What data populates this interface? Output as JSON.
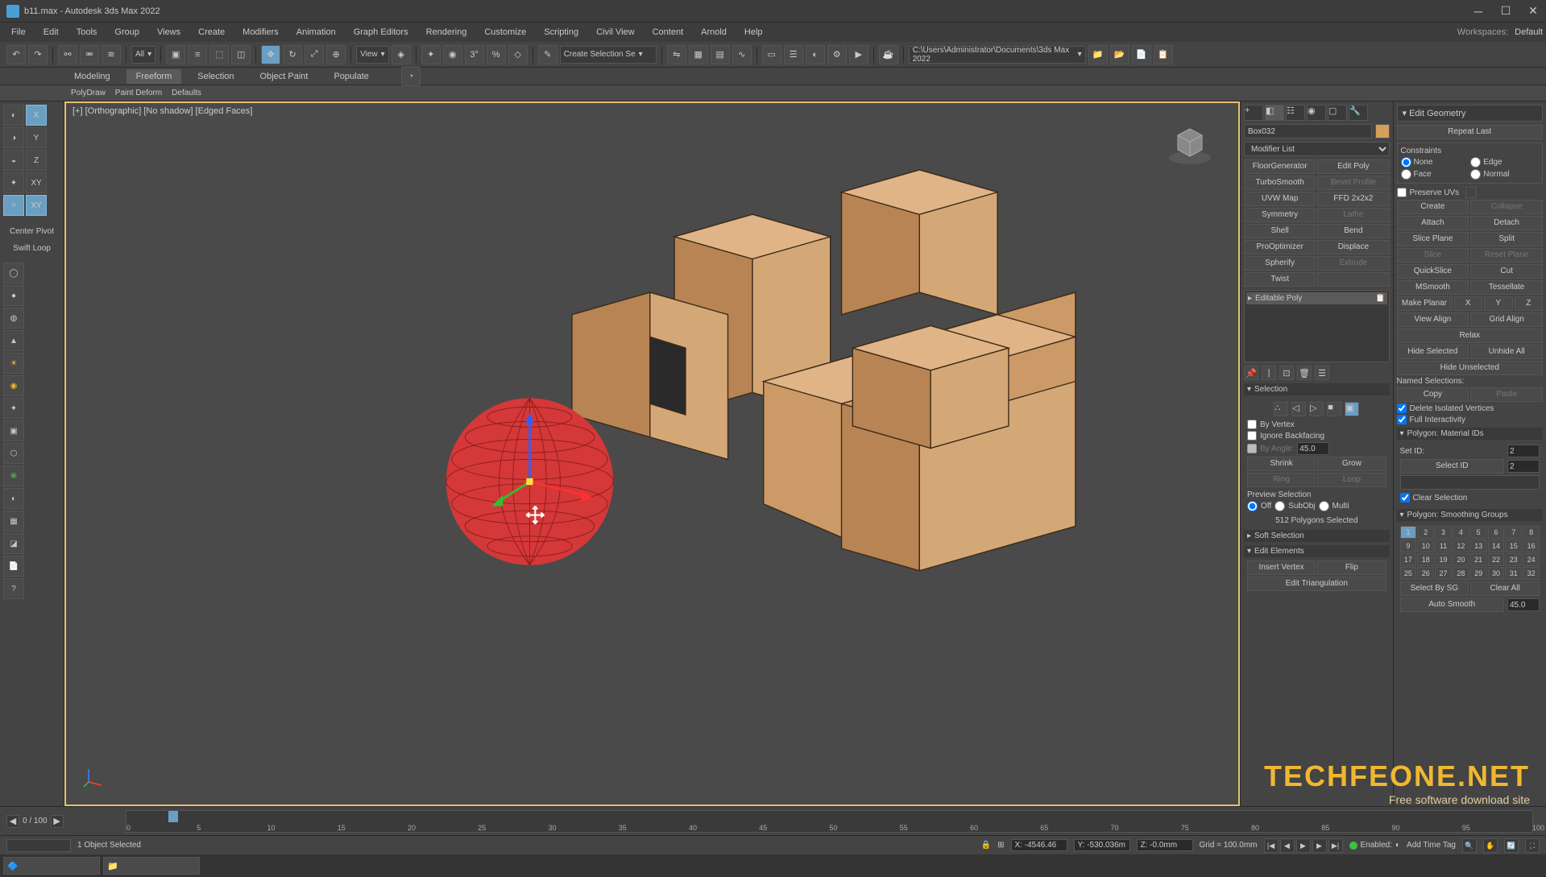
{
  "title": "b11.max - Autodesk 3ds Max 2022",
  "menu": [
    "File",
    "Edit",
    "Tools",
    "Group",
    "Views",
    "Create",
    "Modifiers",
    "Animation",
    "Graph Editors",
    "Rendering",
    "Customize",
    "Scripting",
    "Civil View",
    "Content",
    "Arnold",
    "Help"
  ],
  "workspace_label": "Workspaces:",
  "workspace_value": "Default",
  "toolbar_all": "All",
  "toolbar_view": "View",
  "toolbar_selectionset": "Create Selection Se",
  "toolbar_path": "C:\\Users\\Administrator\\Documents\\3ds Max 2022",
  "ribbon": [
    "Modeling",
    "Freeform",
    "Selection",
    "Object Paint",
    "Populate"
  ],
  "ribbon_active": "Freeform",
  "subribbon": [
    "PolyDraw",
    "Paint Deform",
    "Defaults"
  ],
  "left_axis": [
    "X",
    "Y",
    "Z",
    "XY",
    "XY"
  ],
  "left_labels": [
    "Center Pivot",
    "Swift Loop"
  ],
  "viewport_label": "[+] [Orthographic] [No shadow] [Edged Faces]",
  "object_name": "Box032",
  "modifier_list": "Modifier List",
  "quick_mods": [
    {
      "l": "FloorGenerator",
      "r": "Edit Poly"
    },
    {
      "l": "TurboSmooth",
      "r": "Bevel Profile",
      "rd": true
    },
    {
      "l": "UVW Map",
      "r": "FFD 2x2x2"
    },
    {
      "l": "Symmetry",
      "r": "Lathe",
      "rd": true
    },
    {
      "l": "Shell",
      "r": "Bend"
    },
    {
      "l": "ProOptimizer",
      "r": "Displace"
    },
    {
      "l": "Spherify",
      "r": "Extrude",
      "rd": true
    },
    {
      "l": "Twist",
      "r": ""
    }
  ],
  "stack_item": "Editable Poly",
  "selection_title": "Selection",
  "sel_byvertex": "By Vertex",
  "sel_ignoreback": "Ignore Backfacing",
  "sel_byangle": "By Angle:",
  "sel_angle_val": "45.0",
  "sel_shrink": "Shrink",
  "sel_grow": "Grow",
  "sel_ring": "Ring",
  "sel_loop": "Loop",
  "preview_sel": "Preview Selection",
  "preview_off": "Off",
  "preview_subobj": "SubObj",
  "preview_multi": "Multi",
  "polys_selected": "512 Polygons Selected",
  "soft_sel": "Soft Selection",
  "edit_elements": "Edit Elements",
  "insert_vertex": "Insert Vertex",
  "flip": "Flip",
  "edit_tri": "Edit Triangulation",
  "edit_geom_title": "Edit Geometry",
  "repeat_last": "Repeat Last",
  "constraints": "Constraints",
  "con_none": "None",
  "con_edge": "Edge",
  "con_face": "Face",
  "con_normal": "Normal",
  "preserve_uvs": "Preserve UVs",
  "create": "Create",
  "collapse": "Collapse",
  "attach": "Attach",
  "detach": "Detach",
  "slice_plane": "Slice Plane",
  "split": "Split",
  "slice": "Slice",
  "reset_plane": "Reset Plane",
  "quickslice": "QuickSlice",
  "cut": "Cut",
  "msmooth": "MSmooth",
  "tessellate": "Tessellate",
  "make_planar": "Make Planar",
  "x": "X",
  "y": "Y",
  "z": "Z",
  "view_align": "View Align",
  "grid_align": "Grid Align",
  "relax": "Relax",
  "hide_sel": "Hide Selected",
  "unhide_all": "Unhide All",
  "hide_unsel": "Hide Unselected",
  "named_sel": "Named Selections:",
  "copy": "Copy",
  "paste": "Paste",
  "del_isolated": "Delete Isolated Vertices",
  "full_interact": "Full Interactivity",
  "poly_matids": "Polygon: Material IDs",
  "set_id": "Set ID:",
  "set_id_val": "2",
  "select_id": "Select ID",
  "select_id_val": "2",
  "clear_sel": "Clear Selection",
  "poly_sg": "Polygon: Smoothing Groups",
  "sel_by_sg": "Select By SG",
  "clear_all": "Clear All",
  "auto_smooth": "Auto Smooth",
  "auto_smooth_val": "45.0",
  "frame_counter": "0 / 100",
  "ruler_ticks": [
    0,
    5,
    10,
    15,
    20,
    25,
    30,
    35,
    40,
    45,
    50,
    55,
    60,
    65,
    70,
    75,
    80,
    85,
    90,
    95,
    100
  ],
  "status_sel": "1 Object Selected",
  "coord_x": "X: -4546.46",
  "coord_y": "Y: -530.036m",
  "coord_z": "Z: -0.0mm",
  "grid": "Grid = 100.0mm",
  "enabled": "Enabled:",
  "add_time_tag": "Add Time Tag",
  "watermark_title": "TECHFEONE.NET",
  "watermark_sub": "Free software download site"
}
